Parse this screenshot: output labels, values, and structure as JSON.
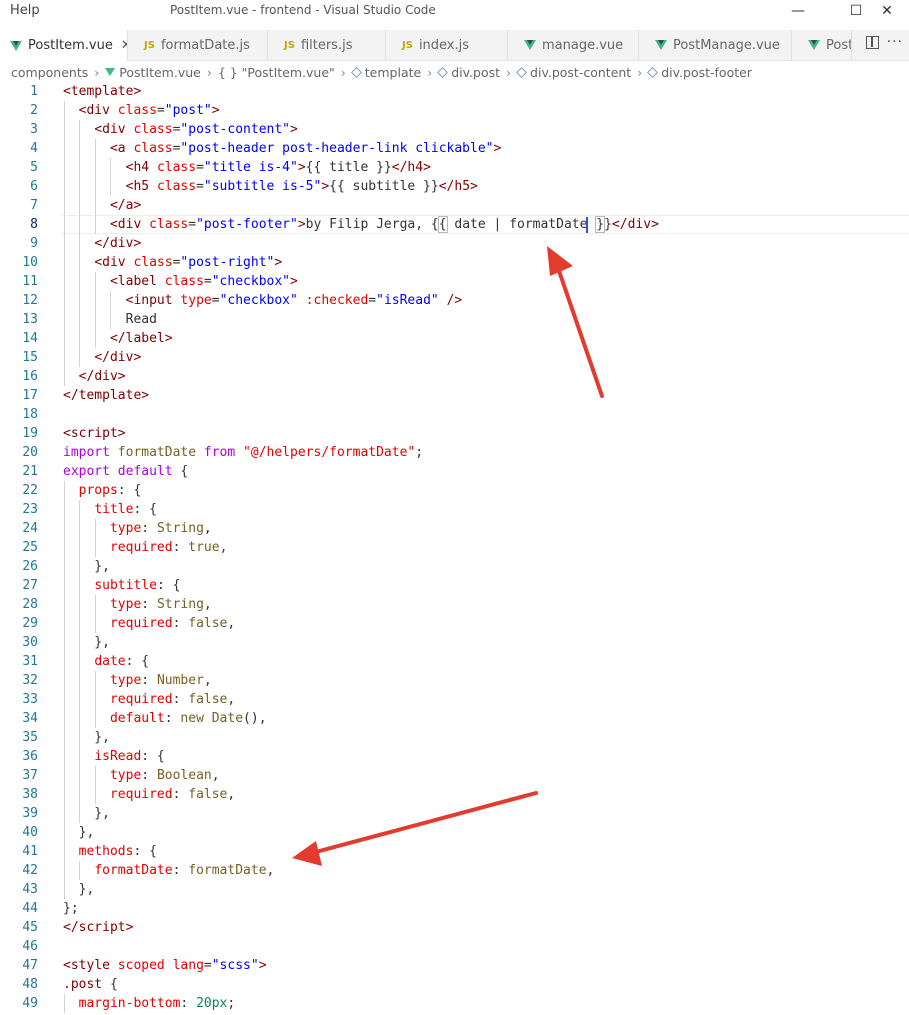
{
  "window": {
    "menu_help": "Help",
    "title": "PostItem.vue - frontend - Visual Studio Code",
    "minimize_glyph": "—",
    "maximize_glyph": "☐",
    "close_glyph": "✕"
  },
  "tabs": [
    {
      "label": "PostItem.vue",
      "icon": "vue-icon",
      "active": true,
      "close": "✕"
    },
    {
      "label": "formatDate.js",
      "icon": "js-icon"
    },
    {
      "label": "filters.js",
      "icon": "js-icon"
    },
    {
      "label": "index.js",
      "icon": "js-icon"
    },
    {
      "label": "manage.vue",
      "icon": "vue-icon"
    },
    {
      "label": "PostManage.vue",
      "icon": "vue-icon"
    },
    {
      "label": "Post",
      "icon": "vue-icon"
    }
  ],
  "js_icon_text": "JS",
  "breadcrumb": {
    "b0": "components",
    "b1": "PostItem.vue",
    "b2": "{ } \"PostItem.vue\"",
    "b3": "template",
    "b4": "div.post",
    "b5": "div.post-content",
    "b6": "div.post-footer",
    "sep": "›"
  },
  "editor": {
    "current_line": 8,
    "lines": [
      {
        "n": "1",
        "t": [
          [
            "<",
            "t-punc"
          ],
          [
            "template",
            "t-tag"
          ],
          [
            ">",
            "t-punc"
          ]
        ]
      },
      {
        "n": "2",
        "t": [
          [
            "  "
          ],
          [
            "<",
            "t-punc"
          ],
          [
            "div",
            "t-tag"
          ],
          [
            " "
          ],
          [
            "class",
            "t-attr"
          ],
          [
            "=",
            "t-plain"
          ],
          [
            "\"post\"",
            "t-str"
          ],
          [
            ">",
            "t-punc"
          ]
        ]
      },
      {
        "n": "3",
        "t": [
          [
            "    "
          ],
          [
            "<",
            "t-punc"
          ],
          [
            "div",
            "t-tag"
          ],
          [
            " "
          ],
          [
            "class",
            "t-attr"
          ],
          [
            "=",
            "t-plain"
          ],
          [
            "\"post-content\"",
            "t-str"
          ],
          [
            ">",
            "t-punc"
          ]
        ]
      },
      {
        "n": "4",
        "t": [
          [
            "      "
          ],
          [
            "<",
            "t-punc"
          ],
          [
            "a",
            "t-tag"
          ],
          [
            " "
          ],
          [
            "class",
            "t-attr"
          ],
          [
            "=",
            "t-plain"
          ],
          [
            "\"post-header post-header-link clickable\"",
            "t-str"
          ],
          [
            ">",
            "t-punc"
          ]
        ]
      },
      {
        "n": "5",
        "t": [
          [
            "        "
          ],
          [
            "<",
            "t-punc"
          ],
          [
            "h4",
            "t-tag"
          ],
          [
            " "
          ],
          [
            "class",
            "t-attr"
          ],
          [
            "=",
            "t-plain"
          ],
          [
            "\"title is-4\"",
            "t-str"
          ],
          [
            ">",
            "t-punc"
          ],
          [
            "{{ title }}",
            "t-plain"
          ],
          [
            "</",
            "t-punc"
          ],
          [
            "h4",
            "t-tag"
          ],
          [
            ">",
            "t-punc"
          ]
        ]
      },
      {
        "n": "6",
        "t": [
          [
            "        "
          ],
          [
            "<",
            "t-punc"
          ],
          [
            "h5",
            "t-tag"
          ],
          [
            " "
          ],
          [
            "class",
            "t-attr"
          ],
          [
            "=",
            "t-plain"
          ],
          [
            "\"subtitle is-5\"",
            "t-str"
          ],
          [
            ">",
            "t-punc"
          ],
          [
            "{{ subtitle }}",
            "t-plain"
          ],
          [
            "</",
            "t-punc"
          ],
          [
            "h5",
            "t-tag"
          ],
          [
            ">",
            "t-punc"
          ]
        ]
      },
      {
        "n": "7",
        "t": [
          [
            "      "
          ],
          [
            "</",
            "t-punc"
          ],
          [
            "a",
            "t-tag"
          ],
          [
            ">",
            "t-punc"
          ]
        ]
      },
      {
        "n": "8",
        "t": [
          [
            "      "
          ],
          [
            "<",
            "t-punc"
          ],
          [
            "div",
            "t-tag"
          ],
          [
            " "
          ],
          [
            "class",
            "t-attr"
          ],
          [
            "=",
            "t-plain"
          ],
          [
            "\"post-footer\"",
            "t-str"
          ],
          [
            ">",
            "t-punc"
          ],
          [
            "by Filip Jerga, {",
            "t-plain"
          ],
          [
            "{",
            "t-plain",
            "hl"
          ],
          [
            " date | formatDate",
            "t-plain"
          ],
          [
            "|cursor"
          ],
          [
            " "
          ],
          [
            "}",
            "t-plain",
            "hl"
          ],
          [
            "}",
            "t-plain"
          ],
          [
            "</",
            "t-punc"
          ],
          [
            "div",
            "t-tag"
          ],
          [
            ">",
            "t-punc"
          ]
        ]
      },
      {
        "n": "9",
        "t": [
          [
            "    "
          ],
          [
            "</",
            "t-punc"
          ],
          [
            "div",
            "t-tag"
          ],
          [
            ">",
            "t-punc"
          ]
        ]
      },
      {
        "n": "10",
        "t": [
          [
            "    "
          ],
          [
            "<",
            "t-punc"
          ],
          [
            "div",
            "t-tag"
          ],
          [
            " "
          ],
          [
            "class",
            "t-attr"
          ],
          [
            "=",
            "t-plain"
          ],
          [
            "\"post-right\"",
            "t-str"
          ],
          [
            ">",
            "t-punc"
          ]
        ]
      },
      {
        "n": "11",
        "t": [
          [
            "      "
          ],
          [
            "<",
            "t-punc"
          ],
          [
            "label",
            "t-tag"
          ],
          [
            " "
          ],
          [
            "class",
            "t-attr"
          ],
          [
            "=",
            "t-plain"
          ],
          [
            "\"checkbox\"",
            "t-str"
          ],
          [
            ">",
            "t-punc"
          ]
        ]
      },
      {
        "n": "12",
        "t": [
          [
            "        "
          ],
          [
            "<",
            "t-punc"
          ],
          [
            "input",
            "t-tag"
          ],
          [
            " "
          ],
          [
            "type",
            "t-attr"
          ],
          [
            "=",
            "t-plain"
          ],
          [
            "\"checkbox\"",
            "t-str"
          ],
          [
            " "
          ],
          [
            ":checked",
            "t-attr"
          ],
          [
            "=",
            "t-plain"
          ],
          [
            "\"isRead\"",
            "t-str"
          ],
          [
            " "
          ],
          [
            "/>",
            "t-punc"
          ]
        ]
      },
      {
        "n": "13",
        "t": [
          [
            "        Read",
            "t-plain"
          ]
        ]
      },
      {
        "n": "14",
        "t": [
          [
            "      "
          ],
          [
            "</",
            "t-punc"
          ],
          [
            "label",
            "t-tag"
          ],
          [
            ">",
            "t-punc"
          ]
        ]
      },
      {
        "n": "15",
        "t": [
          [
            "    "
          ],
          [
            "</",
            "t-punc"
          ],
          [
            "div",
            "t-tag"
          ],
          [
            ">",
            "t-punc"
          ]
        ]
      },
      {
        "n": "16",
        "t": [
          [
            "  "
          ],
          [
            "</",
            "t-punc"
          ],
          [
            "div",
            "t-tag"
          ],
          [
            ">",
            "t-punc"
          ]
        ]
      },
      {
        "n": "17",
        "t": [
          [
            "</",
            "t-punc"
          ],
          [
            "template",
            "t-tag"
          ],
          [
            ">",
            "t-punc"
          ]
        ]
      },
      {
        "n": "18",
        "t": []
      },
      {
        "n": "19",
        "t": [
          [
            "<",
            "t-punc"
          ],
          [
            "script",
            "t-tag"
          ],
          [
            ">",
            "t-punc"
          ]
        ]
      },
      {
        "n": "20",
        "t": [
          [
            "import",
            "t-ctl"
          ],
          [
            " "
          ],
          [
            "formatDate",
            "t-fn"
          ],
          [
            " "
          ],
          [
            "from",
            "t-ctl"
          ],
          [
            " "
          ],
          [
            "\"@/helpers/formatDate\"",
            "t-prop"
          ],
          [
            ";",
            "t-plain"
          ]
        ]
      },
      {
        "n": "21",
        "t": [
          [
            "export",
            "t-ctl"
          ],
          [
            " "
          ],
          [
            "default",
            "t-ctl"
          ],
          [
            " {",
            "t-plain"
          ]
        ]
      },
      {
        "n": "22",
        "t": [
          [
            "  "
          ],
          [
            "props",
            "t-prop"
          ],
          [
            ": {",
            "t-plain"
          ]
        ]
      },
      {
        "n": "23",
        "t": [
          [
            "    "
          ],
          [
            "title",
            "t-prop"
          ],
          [
            ": {",
            "t-plain"
          ]
        ]
      },
      {
        "n": "24",
        "t": [
          [
            "      "
          ],
          [
            "type",
            "t-prop"
          ],
          [
            ": ",
            "t-plain"
          ],
          [
            "String",
            "t-fn"
          ],
          [
            ",",
            "t-plain"
          ]
        ]
      },
      {
        "n": "25",
        "t": [
          [
            "      "
          ],
          [
            "required",
            "t-prop"
          ],
          [
            ": ",
            "t-plain"
          ],
          [
            "true",
            "t-fn"
          ],
          [
            ",",
            "t-plain"
          ]
        ]
      },
      {
        "n": "26",
        "t": [
          [
            "    },",
            "t-plain"
          ]
        ]
      },
      {
        "n": "27",
        "t": [
          [
            "    "
          ],
          [
            "subtitle",
            "t-prop"
          ],
          [
            ": {",
            "t-plain"
          ]
        ]
      },
      {
        "n": "28",
        "t": [
          [
            "      "
          ],
          [
            "type",
            "t-prop"
          ],
          [
            ": ",
            "t-plain"
          ],
          [
            "String",
            "t-fn"
          ],
          [
            ",",
            "t-plain"
          ]
        ]
      },
      {
        "n": "29",
        "t": [
          [
            "      "
          ],
          [
            "required",
            "t-prop"
          ],
          [
            ": ",
            "t-plain"
          ],
          [
            "false",
            "t-fn"
          ],
          [
            ",",
            "t-plain"
          ]
        ]
      },
      {
        "n": "30",
        "t": [
          [
            "    },",
            "t-plain"
          ]
        ]
      },
      {
        "n": "31",
        "t": [
          [
            "    "
          ],
          [
            "date",
            "t-prop"
          ],
          [
            ": {",
            "t-plain"
          ]
        ]
      },
      {
        "n": "32",
        "t": [
          [
            "      "
          ],
          [
            "type",
            "t-prop"
          ],
          [
            ": ",
            "t-plain"
          ],
          [
            "Number",
            "t-fn"
          ],
          [
            ",",
            "t-plain"
          ]
        ]
      },
      {
        "n": "33",
        "t": [
          [
            "      "
          ],
          [
            "required",
            "t-prop"
          ],
          [
            ": ",
            "t-plain"
          ],
          [
            "false",
            "t-fn"
          ],
          [
            ",",
            "t-plain"
          ]
        ]
      },
      {
        "n": "34",
        "t": [
          [
            "      "
          ],
          [
            "default",
            "t-prop"
          ],
          [
            ": ",
            "t-plain"
          ],
          [
            "new",
            "t-fn"
          ],
          [
            " "
          ],
          [
            "Date",
            "t-fn"
          ],
          [
            "(),",
            "t-plain"
          ]
        ]
      },
      {
        "n": "35",
        "t": [
          [
            "    },",
            "t-plain"
          ]
        ]
      },
      {
        "n": "36",
        "t": [
          [
            "    "
          ],
          [
            "isRead",
            "t-prop"
          ],
          [
            ": {",
            "t-plain"
          ]
        ]
      },
      {
        "n": "37",
        "t": [
          [
            "      "
          ],
          [
            "type",
            "t-prop"
          ],
          [
            ": ",
            "t-plain"
          ],
          [
            "Boolean",
            "t-fn"
          ],
          [
            ",",
            "t-plain"
          ]
        ]
      },
      {
        "n": "38",
        "t": [
          [
            "      "
          ],
          [
            "required",
            "t-prop"
          ],
          [
            ": ",
            "t-plain"
          ],
          [
            "false",
            "t-fn"
          ],
          [
            ",",
            "t-plain"
          ]
        ]
      },
      {
        "n": "39",
        "t": [
          [
            "    },",
            "t-plain"
          ]
        ]
      },
      {
        "n": "40",
        "t": [
          [
            "  },",
            "t-plain"
          ]
        ]
      },
      {
        "n": "41",
        "t": [
          [
            "  "
          ],
          [
            "methods",
            "t-prop"
          ],
          [
            ": {",
            "t-plain"
          ]
        ]
      },
      {
        "n": "42",
        "t": [
          [
            "    "
          ],
          [
            "formatDate",
            "t-prop"
          ],
          [
            ": ",
            "t-plain"
          ],
          [
            "formatDate",
            "t-fn"
          ],
          [
            ",",
            "t-plain"
          ]
        ]
      },
      {
        "n": "43",
        "t": [
          [
            "  },",
            "t-plain"
          ]
        ]
      },
      {
        "n": "44",
        "t": [
          [
            "};",
            "t-plain"
          ]
        ]
      },
      {
        "n": "45",
        "t": [
          [
            "</",
            "t-punc"
          ],
          [
            "script",
            "t-tag"
          ],
          [
            ">",
            "t-punc"
          ]
        ]
      },
      {
        "n": "46",
        "t": []
      },
      {
        "n": "47",
        "t": [
          [
            "<",
            "t-punc"
          ],
          [
            "style",
            "t-tag"
          ],
          [
            " "
          ],
          [
            "scoped",
            "t-attr"
          ],
          [
            " "
          ],
          [
            "lang",
            "t-attr"
          ],
          [
            "=",
            "t-plain"
          ],
          [
            "\"scss\"",
            "t-str"
          ],
          [
            ">",
            "t-punc"
          ]
        ]
      },
      {
        "n": "48",
        "t": [
          [
            ".post",
            "t-tag"
          ],
          [
            " {",
            "t-plain"
          ]
        ]
      },
      {
        "n": "49",
        "t": [
          [
            "  "
          ],
          [
            "margin-bottom",
            "t-prop"
          ],
          [
            ": ",
            "t-plain"
          ],
          [
            "20px",
            "t-num"
          ],
          [
            ";",
            "t-plain"
          ]
        ]
      }
    ]
  },
  "annotation_color": "#e33b2e"
}
